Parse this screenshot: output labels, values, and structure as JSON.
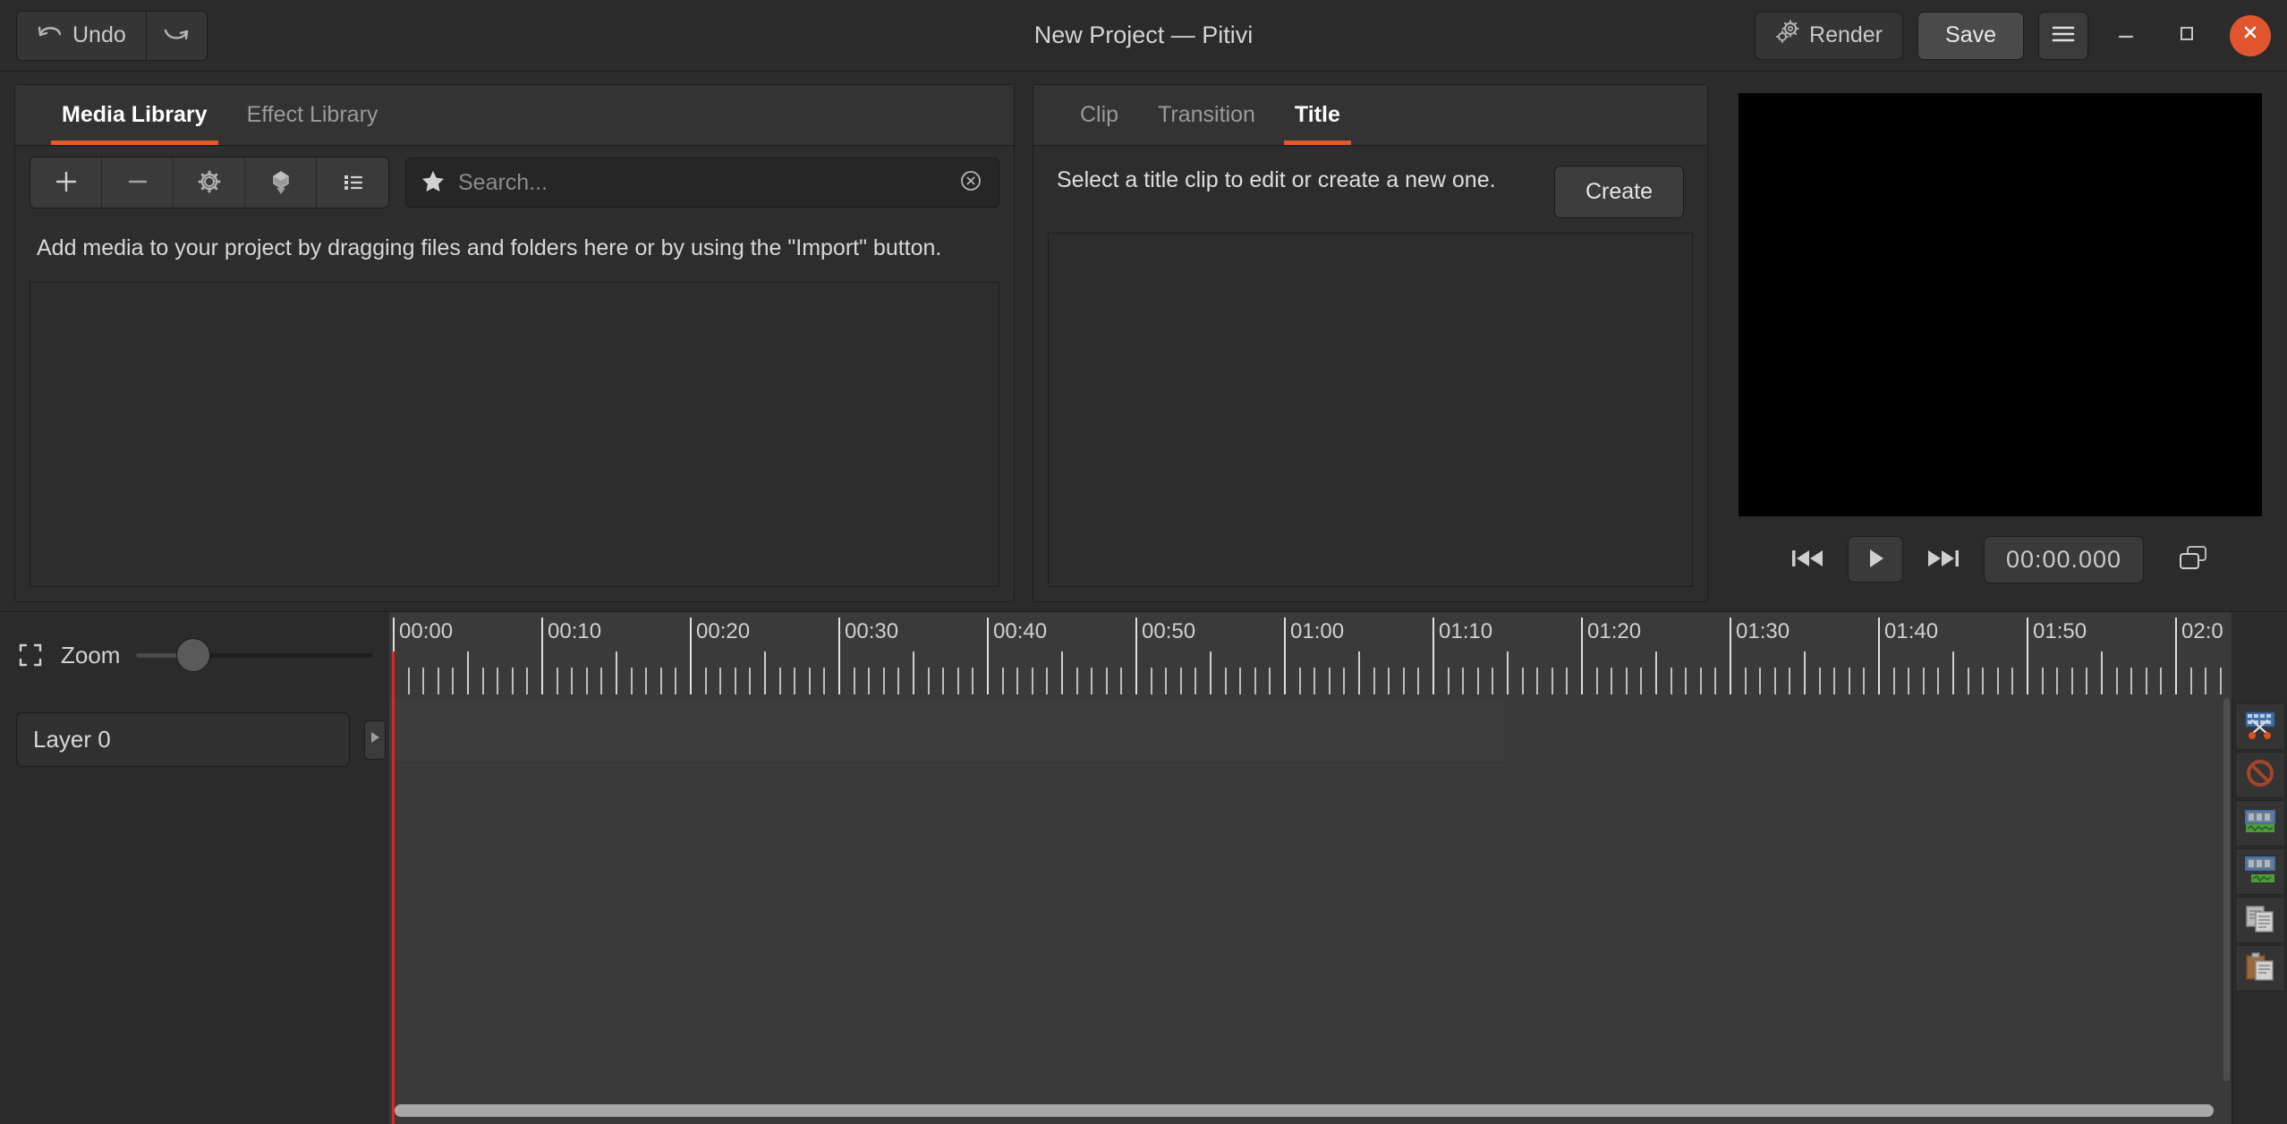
{
  "header": {
    "title": "New Project — Pitivi",
    "undo_label": "Undo",
    "undo_icon": "undo-arrow-icon",
    "redo_icon": "redo-arrow-icon",
    "render_label": "Render",
    "render_icon": "gears-icon",
    "save_label": "Save",
    "menu_icon": "hamburger-menu-icon",
    "minimize_icon": "minimize-icon",
    "maximize_icon": "maximize-icon",
    "close_icon": "close-icon",
    "close_color": "#e0552d"
  },
  "accent_color": "#e35a28",
  "media_library": {
    "tabs": [
      {
        "label": "Media Library",
        "active": true
      },
      {
        "label": "Effect Library",
        "active": false
      }
    ],
    "toolbar": [
      {
        "name": "import-button",
        "icon": "plus-icon"
      },
      {
        "name": "remove-button",
        "icon": "minus-icon"
      },
      {
        "name": "clip-properties-button",
        "icon": "gear-icon"
      },
      {
        "name": "insert-at-playhead-button",
        "icon": "insert-icon"
      },
      {
        "name": "view-mode-button",
        "icon": "list-view-icon"
      }
    ],
    "search": {
      "placeholder": "Search...",
      "value": "",
      "icon": "star-icon",
      "clear_icon": "clear-circle-icon"
    },
    "hint": "Add media to your project by dragging files and folders here or by using the \"Import\" button."
  },
  "middle_panel": {
    "tabs": [
      {
        "label": "Clip",
        "active": false
      },
      {
        "label": "Transition",
        "active": false
      },
      {
        "label": "Title",
        "active": true
      }
    ],
    "title_message": "Select a title clip to edit or create a new one.",
    "create_label": "Create"
  },
  "viewer": {
    "screen_color": "#000000",
    "controls": [
      {
        "name": "go-to-start-button",
        "icon": "skip-backward-icon"
      },
      {
        "name": "play-pause-button",
        "icon": "play-icon"
      },
      {
        "name": "go-to-end-button",
        "icon": "skip-forward-icon"
      }
    ],
    "timecode": "00:00.000",
    "detach_icon": "detach-window-icon"
  },
  "timeline": {
    "zoom_label": "Zoom",
    "zoom_icon": "zoom-fit-icon",
    "zoom_value": 17,
    "playhead_position": "00:00",
    "ruler": {
      "labels": [
        "00:00",
        "00:10",
        "00:20",
        "00:30",
        "00:40",
        "00:50",
        "01:00",
        "01:10",
        "01:20",
        "01:30",
        "01:40",
        "01:50",
        "02:0"
      ],
      "interval_seconds": 10,
      "pixels_per_major": 166
    },
    "layers": [
      {
        "name": "Layer 0",
        "menu_icon": "layer-menu-icon"
      }
    ],
    "toolbar": [
      {
        "name": "split-clip-button",
        "icon": "split-scissors-icon"
      },
      {
        "name": "delete-clip-button",
        "icon": "no-entry-icon"
      },
      {
        "name": "group-clips-button",
        "icon": "group-clips-icon"
      },
      {
        "name": "ungroup-clips-button",
        "icon": "ungroup-clips-icon"
      },
      {
        "name": "copy-button",
        "icon": "copy-documents-icon"
      },
      {
        "name": "paste-button",
        "icon": "paste-clipboard-icon"
      }
    ]
  }
}
